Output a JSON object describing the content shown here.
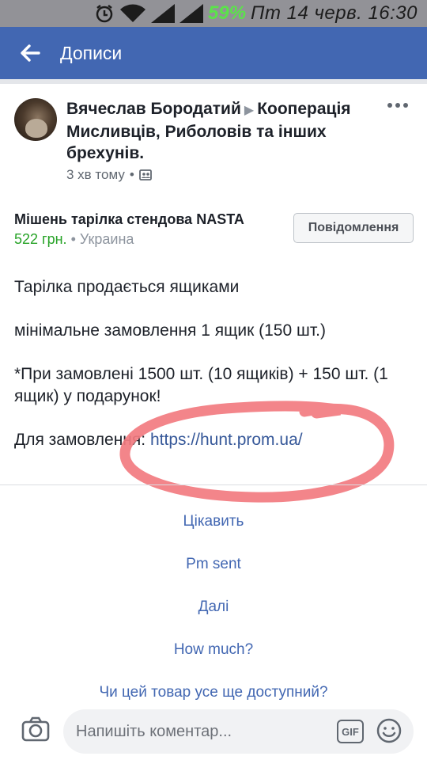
{
  "status_bar": {
    "battery": "59%",
    "datetime": "Пт 14 черв. 16:30",
    "icons": [
      "alarm-icon",
      "wifi-icon",
      "signal-icon",
      "signal-icon"
    ]
  },
  "app_bar": {
    "back_icon": "arrow-left-icon",
    "title": "Дописи"
  },
  "post": {
    "author": "Вячеслав Бородатий",
    "group": "Кооперація Мисливців, Риболовів та інших брехунів.",
    "time": "3 хв тому",
    "audience_icon": "group-icon",
    "product": {
      "title": "Мішень тарілка стендова NASTA",
      "price": "522 грн.",
      "location": "Украина"
    },
    "message_button": "Повідомлення",
    "body": {
      "line1": "Тарілка продається ящиками",
      "line2": "мінімальне замовлення 1 ящик (150 шт.)",
      "line3": "*При замовлені 1500 шт. (10 ящиків) + 150 шт. (1 ящик) у подарунок!",
      "line4_prefix": "Для замовлення:",
      "line4_link": "https://hunt.prom.ua/"
    }
  },
  "quick_replies": [
    "Цікавить",
    "Pm sent",
    "Далі",
    "How much?",
    "Чи цей товар усе ще доступний?"
  ],
  "composer": {
    "placeholder": "Напишіть коментар...",
    "gif_label": "GIF",
    "camera_icon": "camera-icon",
    "emoji_icon": "smiley-icon"
  },
  "colors": {
    "brand": "#4267b2",
    "price": "#27a327",
    "annotation": "#f27b80"
  }
}
